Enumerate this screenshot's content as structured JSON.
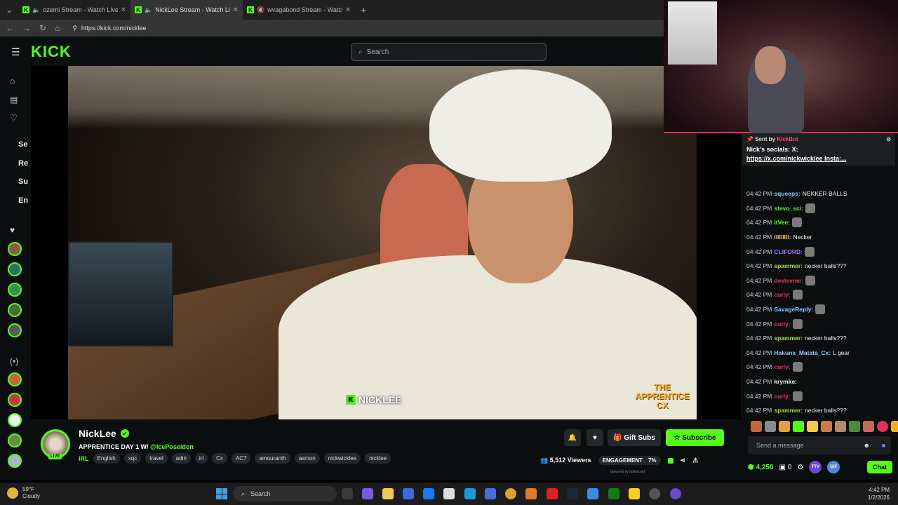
{
  "browser": {
    "tabs": [
      {
        "title": "ozemi Stream - Watch Live on Kick",
        "active": false
      },
      {
        "title": "NickLee Stream - Watch Live on Kick",
        "active": true
      },
      {
        "title": "wvagabond Stream - Watch Live on Kick",
        "active": false
      }
    ],
    "url": "https://kick.com/nicklee",
    "new_tab": "+"
  },
  "header": {
    "logo": "KICK",
    "search_placeholder": "Search"
  },
  "sidebar": {
    "text_items": [
      "Se",
      "Re",
      "Su",
      "En"
    ]
  },
  "video": {
    "watermark": "NICKLEE",
    "show_logo": "THE APPRENTICE CX"
  },
  "chat": {
    "pinned": {
      "sent_by_label": "Sent by",
      "sender": "KickBot",
      "message_prefix": "Nick's socials: X:",
      "message_link": "https://x.com/nickwicklee Insta:..."
    },
    "messages": [
      {
        "time": "04:42 PM",
        "user": "squeeps:",
        "text": "NEKKER BALLS",
        "color": "#8ecbff"
      },
      {
        "time": "04:42 PM",
        "user": "stevo_sci:",
        "text": "",
        "color": "#53fc18",
        "emote": true
      },
      {
        "time": "04:42 PM",
        "user": "itVee:",
        "text": "",
        "color": "#53fc18",
        "emote": true
      },
      {
        "time": "04:42 PM",
        "user": "lllllllll:",
        "text": "Necker",
        "color": "#f2c94c"
      },
      {
        "time": "04:42 PM",
        "user": "CLIFORD:",
        "text": "",
        "color": "#a67cff",
        "emote": true
      },
      {
        "time": "04:42 PM",
        "user": "spammer:",
        "text": "necker balls???",
        "color": "#a3e635"
      },
      {
        "time": "04:42 PM",
        "user": "devlevme:",
        "text": "",
        "color": "#e0325a",
        "emote": true
      },
      {
        "time": "04:42 PM",
        "user": "curly:",
        "text": "",
        "color": "#e0325a",
        "emote": true
      },
      {
        "time": "04:42 PM",
        "user": "SavageReply:",
        "text": "",
        "color": "#8ecbff",
        "emote": true
      },
      {
        "time": "04:42 PM",
        "user": "curly:",
        "text": "",
        "color": "#e0325a",
        "emote": true
      },
      {
        "time": "04:42 PM",
        "user": "spammer:",
        "text": "necker balls???",
        "color": "#a3e635"
      },
      {
        "time": "04:42 PM",
        "user": "Hakuna_Matata_Cx:",
        "text": "L gear",
        "color": "#8ecbff"
      },
      {
        "time": "04:42 PM",
        "user": "curly:",
        "text": "",
        "color": "#e0325a",
        "emote": true
      },
      {
        "time": "04:42 PM",
        "user": "krymke:",
        "text": "",
        "color": "#eeeeee",
        "emote": false
      },
      {
        "time": "04:42 PM",
        "user": "curly:",
        "text": "",
        "color": "#e0325a",
        "emote": true
      },
      {
        "time": "04:42 PM",
        "user": "spammer:",
        "text": "necker balls???",
        "color": "#a3e635"
      }
    ],
    "input_placeholder": "Send a message",
    "points": "4,250",
    "drops_count": "0",
    "badges": [
      "TTV",
      "GIF"
    ],
    "chat_button": "Chat"
  },
  "stream": {
    "channel_name": "NickLee",
    "live_label": "LIVE",
    "title_prefix": "APPRENTICE DAY 1 W/",
    "title_mention": "@IcePoseidon",
    "category": "IRL",
    "tags": [
      "English",
      "xqc",
      "travel",
      "adin",
      "irl",
      "Cx",
      "AC7",
      "amouranth",
      "asmon",
      "nickwicklee",
      "nicklee"
    ],
    "gift_subs_label": "Gift Subs",
    "subscribe_label": "Subscribe",
    "viewers": "5,512 Viewers",
    "engagement_label": "ENGAGEMENT",
    "engagement_value": "7%",
    "powered_by": "powered by botted.wtf"
  },
  "taskbar": {
    "temperature": "59°F",
    "condition": "Cloudy",
    "search_label": "Search",
    "time": "4:42 PM",
    "date": "1/2/2026"
  }
}
